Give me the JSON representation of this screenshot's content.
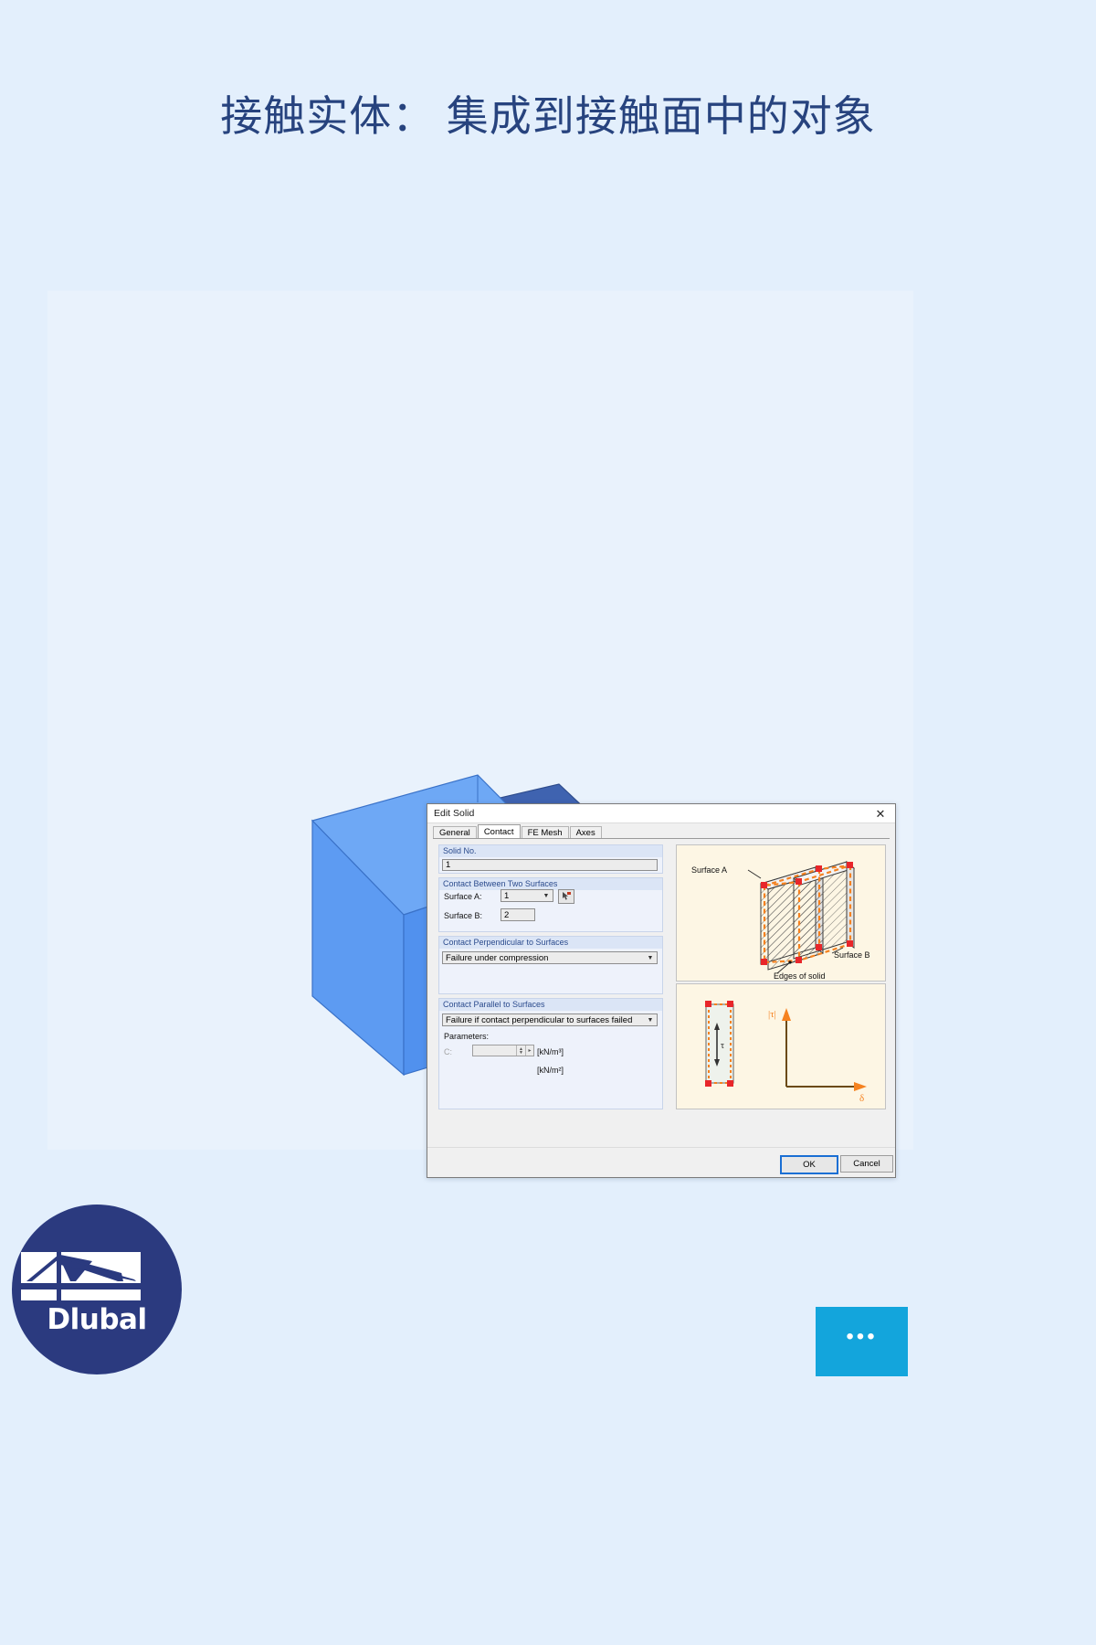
{
  "page": {
    "title": "接触实体： 集成到接触面中的对象",
    "background_color": "#e3effc",
    "canvas_color": "#e9f2fc"
  },
  "model": {
    "description": "等轴测 3D 视图：蓝色实体立方体位于蓝色/青色板上",
    "colors": {
      "cube_top": "#6ea8f5",
      "cube_front": "#5d9bf2",
      "cube_side": "#4e8de8",
      "slab_top": "#3f63b0",
      "slab_front": "#b8dcd2",
      "slab_side": "#a6d2c7"
    }
  },
  "dialog": {
    "title": "Edit Solid",
    "close_icon": "close-icon",
    "tabs": [
      {
        "label": "General",
        "selected": false
      },
      {
        "label": "Contact",
        "selected": true
      },
      {
        "label": "FE Mesh",
        "selected": false
      },
      {
        "label": "Axes",
        "selected": false
      }
    ],
    "groups": {
      "solid_no": {
        "caption": "Solid No.",
        "value": "1"
      },
      "contact_between": {
        "caption": "Contact Between Two Surfaces",
        "surface_a_label": "Surface A:",
        "surface_a_value": "1",
        "pick_icon": "pick-surface-icon",
        "surface_b_label": "Surface B:",
        "surface_b_value": "2"
      },
      "perpendicular": {
        "caption": "Contact Perpendicular to Surfaces",
        "selected": "Failure under compression"
      },
      "parallel": {
        "caption": "Contact Parallel to Surfaces",
        "selected": "Failure if contact perpendicular to surfaces failed",
        "parameters_label": "Parameters:",
        "c_label": "C:",
        "c_value": "",
        "c_unit": "[kN/m³]",
        "second_unit": "[kN/m²]"
      }
    },
    "illustrations": {
      "top": {
        "label_surface_a": "Surface A",
        "label_surface_b": "Surface B",
        "label_edges": "Edges of solid",
        "accent_color": "#f58220",
        "node_color": "#e8262a"
      },
      "bottom": {
        "label_tau": "τ",
        "axis_y": "|τ|",
        "axis_x": "δ",
        "accent_color": "#f58220"
      }
    },
    "buttons": {
      "ok": "OK",
      "cancel": "Cancel"
    }
  },
  "branding": {
    "logo_name": "Dlubal",
    "logo_icon": "dlubal-bridge-icon",
    "logo_color": "#2b3a7f"
  },
  "more_button": {
    "label": "•••",
    "color": "#13a5dc"
  }
}
